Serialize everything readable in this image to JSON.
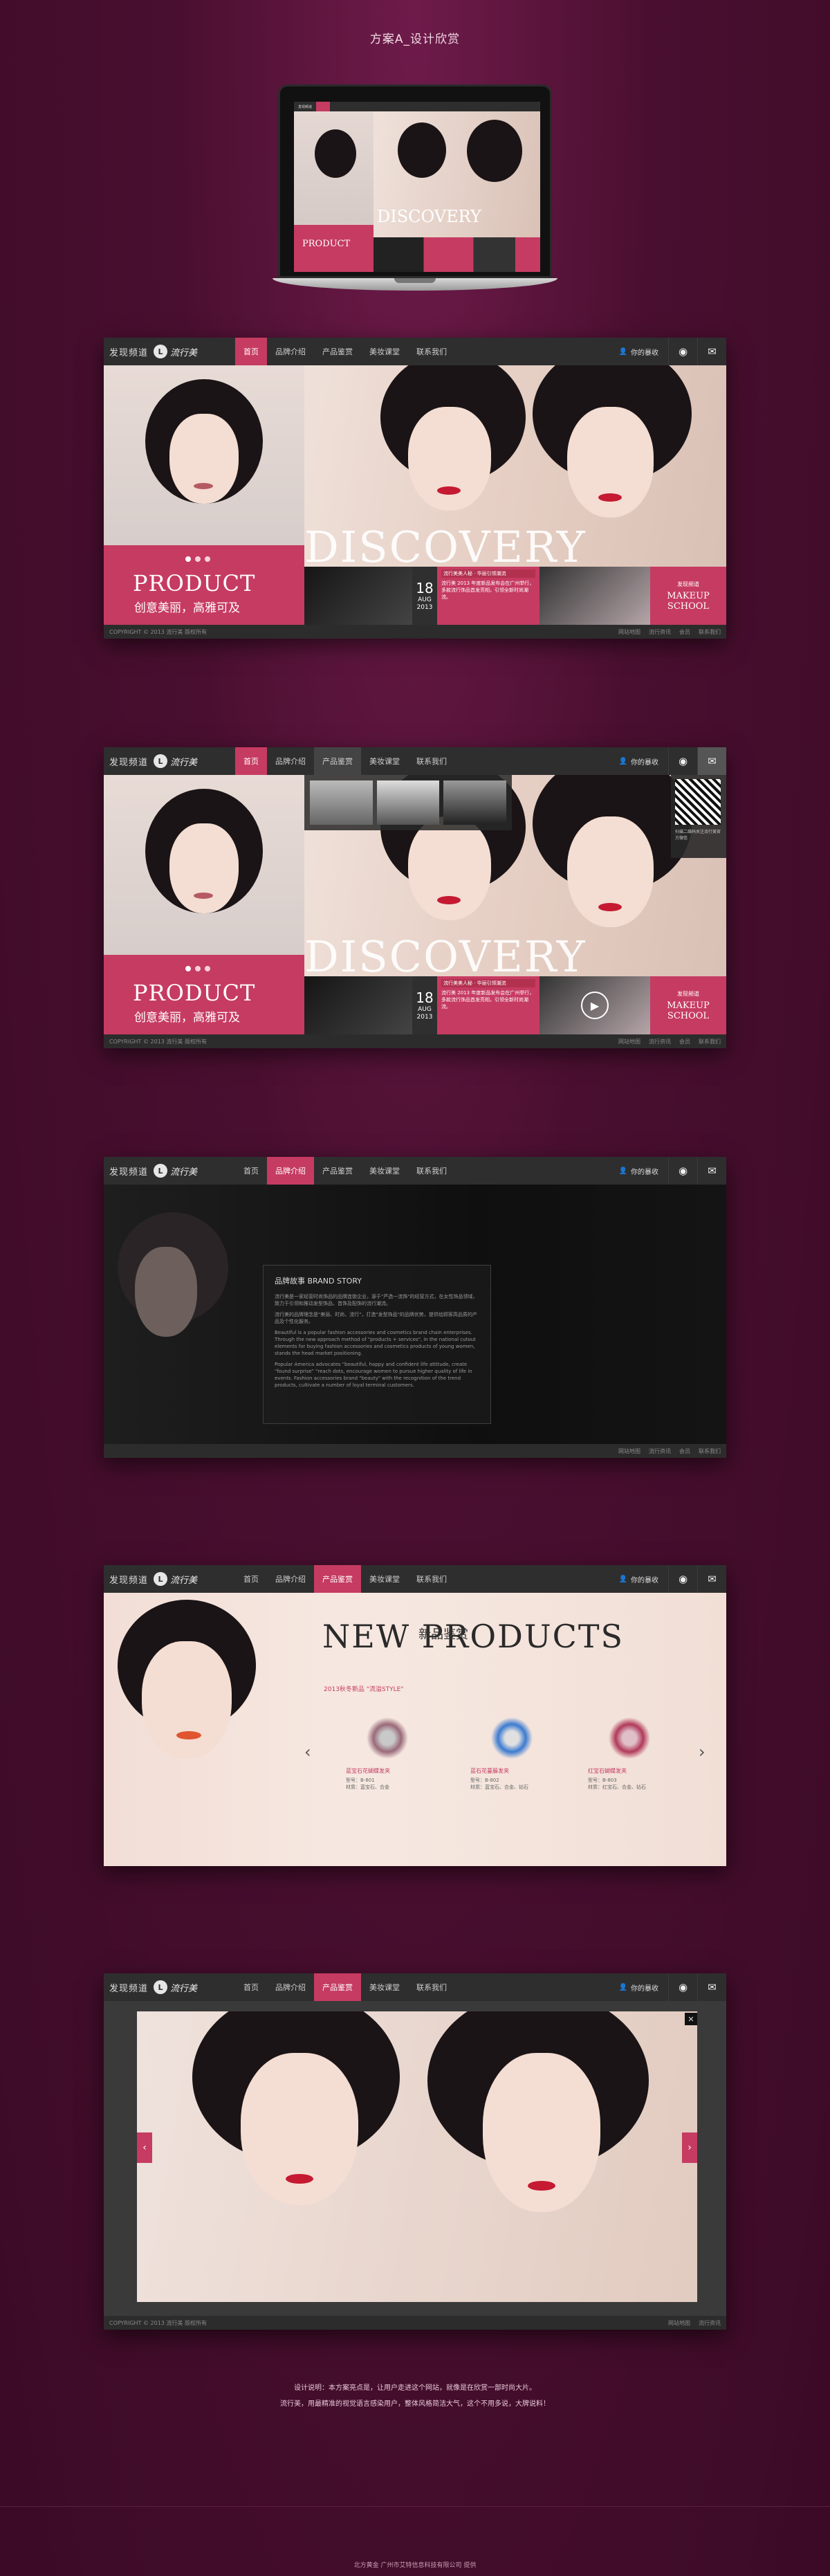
{
  "page": {
    "title": "方案A_设计欣赏",
    "description_lines": [
      "设计说明：本方案亮点是，让用户走进这个网站，就像是在欣赏一部时尚大片。",
      "流行美，用最精准的视觉语言感染用户，整体风格简洁大气，这个不用多说，大牌说料！"
    ],
    "credit": "北方黄金 广州市艾特信息科技有限公司 提供"
  },
  "site": {
    "logo_cn": "发现频道",
    "logo_brand": "流行美",
    "nav": [
      "首页",
      "品牌介绍",
      "产品鉴赏",
      "美妆课堂",
      "联系我们"
    ],
    "user_label": "你的暴收",
    "footer_left": "COPYRIGHT © 2013 流行美 版权所有",
    "footer_links": [
      "网站地图",
      "流行资讯",
      "会员",
      "联系我们"
    ]
  },
  "home": {
    "discovery": "DISCOVERY",
    "product_title": "PRODUCT",
    "product_sub": "创意美丽，高雅可及",
    "date_day": "18",
    "date_month": "AUG 2013",
    "news_title": "流行美美人秘 · 华丽引领潮流",
    "news_text": "流行美 2013 年度新品发布会在广州举行，多款流行饰品首发亮相，引领全新时尚潮流。",
    "school_small": "发现频道",
    "school_title": "MAKEUP SCHOOL"
  },
  "wechat": {
    "qr_caption": "扫描二维码关注流行美官方微信"
  },
  "story": {
    "heading": "品牌故事 BRAND STORY",
    "paragraphs": [
      "流行美是一家经营时尚饰品的品牌连锁企业，源于\"严选一流饰\"的经营方式，在女性饰品领域，致力于引领和推动发型饰品、首饰及配饰的流行潮流。",
      "流行美的品牌理念是\"美丽、时尚、流行\"，打造\"发型饰品\"的品牌优势，提供给顾客高品质的产品及个性化服务。",
      "Beautiful is a popular fashion accessories and cosmetics brand chain enterprises. Through the new approach method of \"products + services\", in the national cutout elements for buying fashion accessories and cosmetics products of young women, stands the head market positioning.",
      "Popular America advocates \"beautiful, happy and confident life attitude, create \"found surprise\" \"reach dots, encourage women to pursue higher quality of life in events. Fashion accessories brand \"beauty\" with the recognition of the trend products, cultivate a number of loyal terminal customers."
    ]
  },
  "products": {
    "title": "NEW PRODUCTS",
    "title_cn": "新品鉴赏",
    "subtitle": "2013秋冬新品 \"流溢STYLE\"",
    "items": [
      {
        "name": "蓝宝石花蝴蝶发夹",
        "code": "型号：B-801",
        "material": "材质：蓝宝石、合金"
      },
      {
        "name": "蓝石花蔓藤发夹",
        "code": "型号：B-802",
        "material": "材质：蓝宝石、合金、钻石"
      },
      {
        "name": "红宝石蝴蝶发夹",
        "code": "型号：B-803",
        "material": "材质：红宝石、合金、钻石"
      }
    ]
  },
  "colors": {
    "accent": "#c63b62",
    "nav": "#2e2e2e",
    "bg": "#4a0f30"
  },
  "icons": [
    "user-icon",
    "weibo-icon",
    "wechat-icon",
    "chevron-left-icon",
    "chevron-right-icon",
    "close-icon"
  ]
}
